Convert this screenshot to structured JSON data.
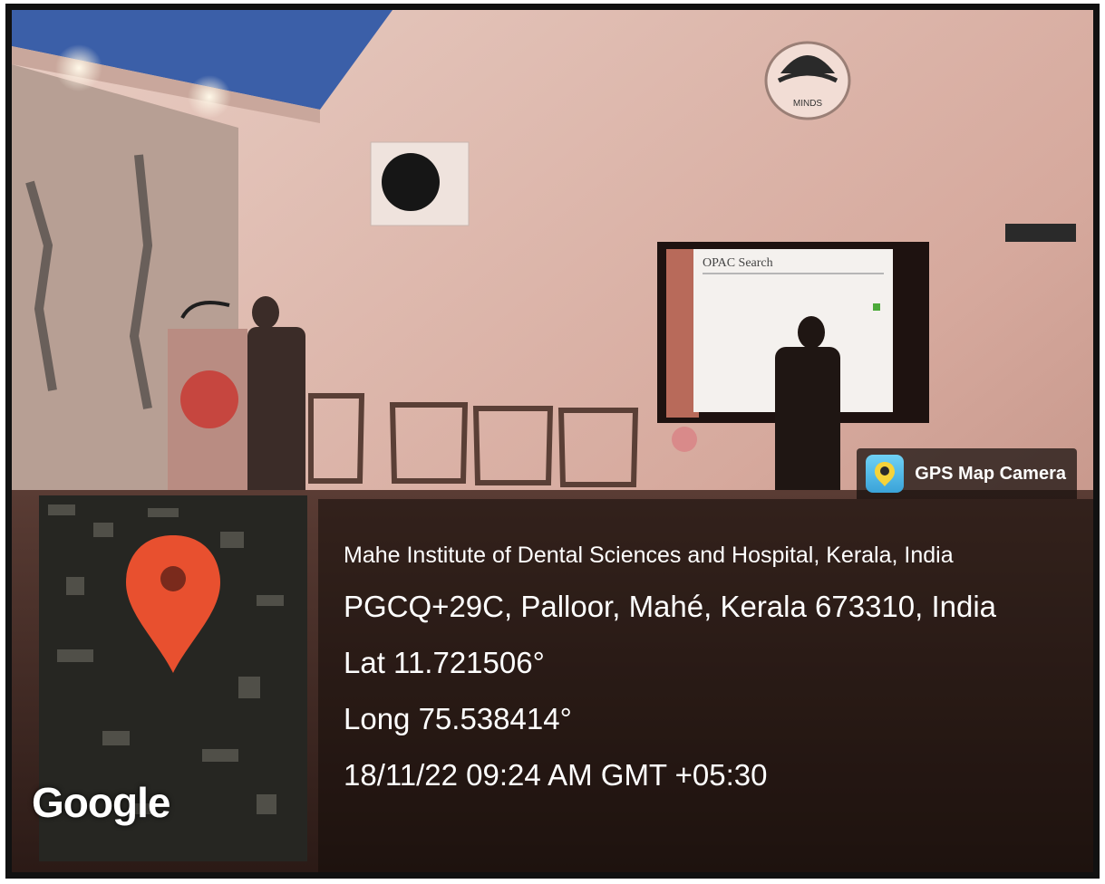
{
  "watermark": {
    "app_name": "GPS Map Camera",
    "app_icon": "gps-map-camera-app-icon",
    "map_brand": "Google",
    "pin_icon": "map-pin-icon"
  },
  "location": {
    "place": "Mahe Institute of Dental Sciences and Hospital, Kerala, India",
    "address": "PGCQ+29C, Palloor, Mahé, Kerala 673310, India",
    "latitude": "Lat 11.721506°",
    "longitude": "Long 75.538414°",
    "datetime": "18/11/22 09:24 AM GMT +05:30"
  },
  "scene": {
    "screen_title": "OPAC Search",
    "logo_text": "MINDS"
  },
  "colors": {
    "pin": "#e8502f",
    "wall": "#d9b3a7",
    "overlay_text": "#ffffff"
  }
}
